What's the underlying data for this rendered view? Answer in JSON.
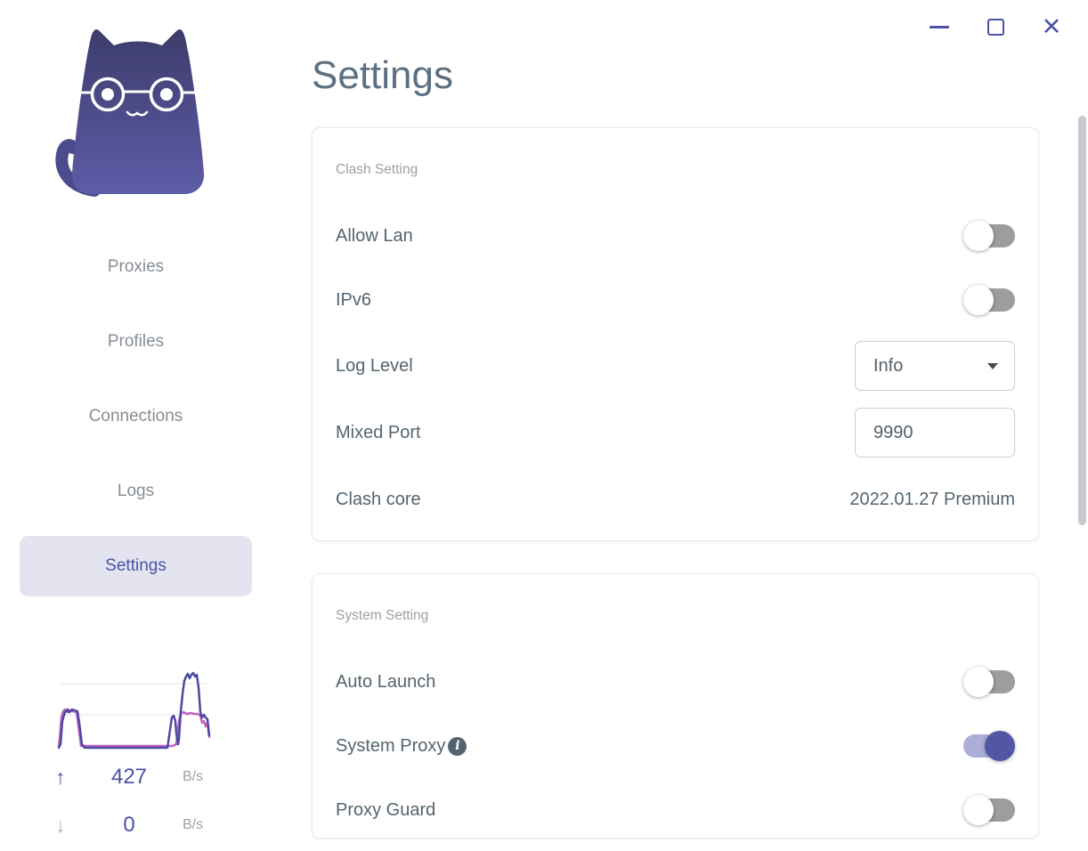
{
  "window_controls": {
    "close_glyph": "✕"
  },
  "page": {
    "title": "Settings"
  },
  "sidebar": {
    "nav": [
      {
        "label": "Proxies",
        "active": false
      },
      {
        "label": "Profiles",
        "active": false
      },
      {
        "label": "Connections",
        "active": false
      },
      {
        "label": "Logs",
        "active": false
      },
      {
        "label": "Settings",
        "active": true
      }
    ],
    "traffic": {
      "up_arrow": "↑",
      "up_value": "427",
      "up_unit": "B/s",
      "down_arrow": "↓",
      "down_value": "0",
      "down_unit": "B/s",
      "graph": {
        "upload_color": "#4b4aa0",
        "download_color": "#c35fc3",
        "gridline_color": "#ededed",
        "description": "sparkline of recent traffic: small peak at left (~mid level), flat period, narrow spike then large upload peak above top gridline with download plateau at mid level"
      }
    }
  },
  "clash_setting": {
    "section_title": "Clash Setting",
    "allow_lan": {
      "label": "Allow Lan",
      "state": "off"
    },
    "ipv6": {
      "label": "IPv6",
      "state": "off"
    },
    "log_level": {
      "label": "Log Level",
      "value": "Info"
    },
    "mixed_port": {
      "label": "Mixed Port",
      "value": "9990"
    },
    "clash_core": {
      "label": "Clash core",
      "value": "2022.01.27 Premium"
    }
  },
  "system_setting": {
    "section_title": "System Setting",
    "auto_launch": {
      "label": "Auto Launch",
      "state": "off"
    },
    "system_proxy": {
      "label": "System Proxy",
      "state": "on",
      "info_glyph": "i"
    },
    "proxy_guard": {
      "label": "Proxy Guard",
      "state": "off"
    }
  },
  "colors": {
    "accent_indigo": "#4d54a3",
    "toggle_on_track": "#abaed6",
    "toggle_on_knob": "#5157a4",
    "toggle_off_track": "#9d9d9d",
    "nav_text": "#878e95",
    "nav_active_bg": "#e4e4f1",
    "nav_active_text": "#4a54a4",
    "title_text": "#5c7081",
    "label_text": "#54646f",
    "section_text": "#9aa1a7",
    "logo_gradient_top": "#3d3c6b",
    "logo_gradient_bottom": "#5d5ca8"
  }
}
